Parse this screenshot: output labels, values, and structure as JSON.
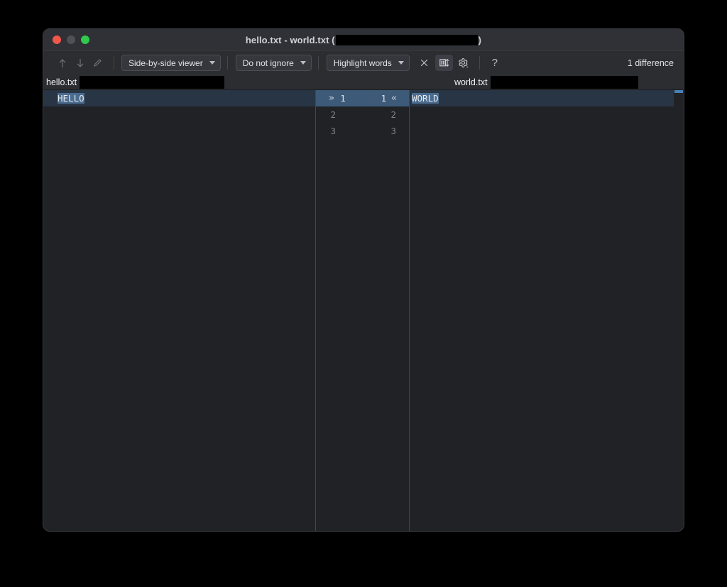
{
  "window": {
    "title_prefix": "hello.txt - world.txt (",
    "title_suffix": ")",
    "traffic_lights": [
      "close",
      "minimize",
      "zoom"
    ]
  },
  "toolbar": {
    "prev_diff_label": "Previous difference",
    "next_diff_label": "Next difference",
    "edit_label": "Edit",
    "viewer_mode": "Side-by-side viewer",
    "ignore_mode": "Do not ignore",
    "highlight_mode": "Highlight words",
    "collapse_label": "Collapse unchanged fragments",
    "sync_scroll_label": "Synchronize scrolling",
    "settings_label": "Settings",
    "help_label": "?",
    "difference_count": "1 difference"
  },
  "files": {
    "left_name": "hello.txt",
    "right_name": "world.txt"
  },
  "diff": {
    "left_lines": [
      {
        "num": "1",
        "text": "HELLO",
        "changed": true
      },
      {
        "num": "2",
        "text": "",
        "changed": false
      },
      {
        "num": "3",
        "text": "",
        "changed": false
      }
    ],
    "right_lines": [
      {
        "num": "1",
        "text": "WORLD",
        "changed": true
      },
      {
        "num": "2",
        "text": "",
        "changed": false
      },
      {
        "num": "3",
        "text": "",
        "changed": false
      }
    ],
    "accept_left_to_right_glyph": "»",
    "accept_right_to_left_glyph": "«"
  },
  "colors": {
    "window_bg": "#2b2d31",
    "titlebar_bg": "#2f3136",
    "editor_bg": "#212225",
    "diff_row_bg": "#283544",
    "diff_gutter_bg": "#3d5a78",
    "word_highlight_bg": "#4a6c90",
    "marker": "#4a7fb5",
    "traffic_red": "#f1564a",
    "traffic_yellow": "#4f5156",
    "traffic_green": "#30c94c"
  }
}
